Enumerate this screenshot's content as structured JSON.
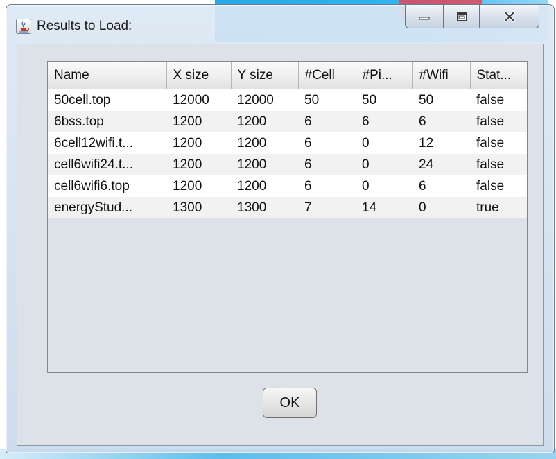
{
  "window": {
    "title": "Results to Load:"
  },
  "table": {
    "columns": [
      "Name",
      "X size",
      "Y size",
      "#Cell",
      "#Pi...",
      "#Wifi",
      "Stat..."
    ],
    "rows": [
      [
        "50cell.top",
        "12000",
        "12000",
        "50",
        "50",
        "50",
        "false"
      ],
      [
        "6bss.top",
        "1200",
        "1200",
        "6",
        "6",
        "6",
        "false"
      ],
      [
        "6cell12wifi.t...",
        "1200",
        "1200",
        "6",
        "0",
        "12",
        "false"
      ],
      [
        "cell6wifi24.t...",
        "1200",
        "1200",
        "6",
        "0",
        "24",
        "false"
      ],
      [
        "cell6wifi6.top",
        "1200",
        "1200",
        "6",
        "0",
        "6",
        "false"
      ],
      [
        "energyStud...",
        "1300",
        "1300",
        "7",
        "14",
        "0",
        "true"
      ]
    ]
  },
  "buttons": {
    "ok_label": "OK"
  },
  "icons": {
    "app": "java-cup-icon",
    "minimize": "minimize-icon",
    "maximize": "maximize-icon",
    "close": "close-icon"
  }
}
